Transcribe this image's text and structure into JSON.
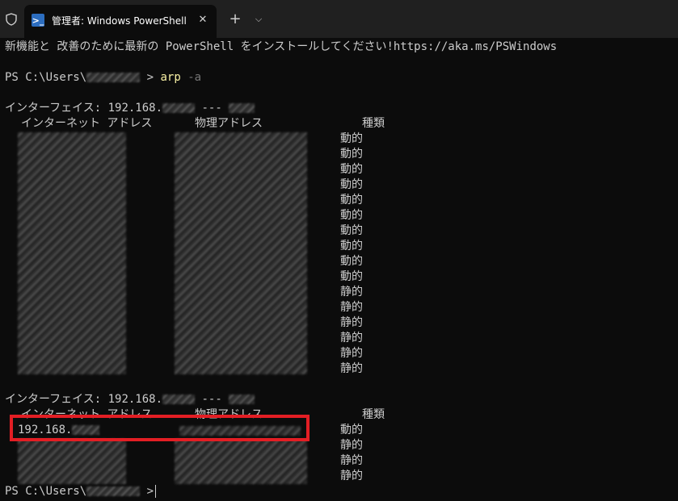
{
  "window": {
    "tab_title": "管理者: Windows PowerShell",
    "tab_icon": "powershell-icon",
    "close_glyph": "✕",
    "new_tab_glyph": "+",
    "dropdown_glyph": "⌵"
  },
  "terminal": {
    "banner": "新機能と 改善のために最新の PowerShell をインストールしてください!https://aka.ms/PSWindows",
    "prompt_prefix": "PS C:\\Users\\",
    "prompt_suffix": ">",
    "command": "arp",
    "command_param": "-a",
    "section1": {
      "interface_label": "インターフェイス: 192.168.",
      "interface_dashes": "---",
      "header_address": "インターネット アドレス",
      "header_physical": "物理アドレス",
      "header_type": "種類",
      "types": [
        "動的",
        "動的",
        "動的",
        "動的",
        "動的",
        "動的",
        "動的",
        "動的",
        "動的",
        "動的",
        "静的",
        "静的",
        "静的",
        "静的",
        "静的",
        "静的"
      ]
    },
    "section2": {
      "interface_label": "インターフェイス: 192.168.",
      "interface_dashes": "---",
      "header_address": "インターネット アドレス",
      "header_physical": "物理アドレス",
      "header_type": "種類",
      "first_address": "192.168.",
      "types": [
        "動的",
        "静的",
        "静的",
        "静的"
      ]
    },
    "final_prompt_prefix": "PS C:\\Users\\",
    "final_prompt_suffix": ">"
  },
  "colors": {
    "background": "#0c0c0c",
    "text": "#cccccc",
    "command": "#f9f1a5",
    "highlight_box": "#e31e24"
  }
}
